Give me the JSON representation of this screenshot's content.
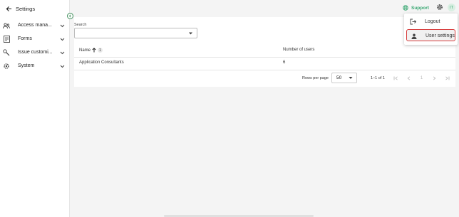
{
  "sidebar": {
    "title": "Settings",
    "items": [
      {
        "label": "Access mana...",
        "icon": "users-icon"
      },
      {
        "label": "Forms",
        "icon": "forms-icon"
      },
      {
        "label": "Issue customi...",
        "icon": "wrench-icon"
      },
      {
        "label": "System",
        "icon": "gear-icon"
      }
    ]
  },
  "header": {
    "support_label": "Support",
    "avatar_initials": "IT"
  },
  "search": {
    "label": "Search",
    "value": ""
  },
  "table": {
    "columns": [
      "Name",
      "Number of users"
    ],
    "sort_badge": "1",
    "rows": [
      {
        "name": "Application Consultants",
        "users": "6"
      }
    ]
  },
  "pagination": {
    "rows_per_page_label": "Rows per page",
    "rows_per_page_value": "50",
    "range_text": "1–1 of 1",
    "page": "1"
  },
  "menu": {
    "items": [
      {
        "label": "Logout",
        "icon": "logout-icon"
      },
      {
        "label": "User settings",
        "icon": "person-icon"
      }
    ]
  },
  "colors": {
    "accent": "#3aa873",
    "selected_outline": "#d63b3b"
  }
}
